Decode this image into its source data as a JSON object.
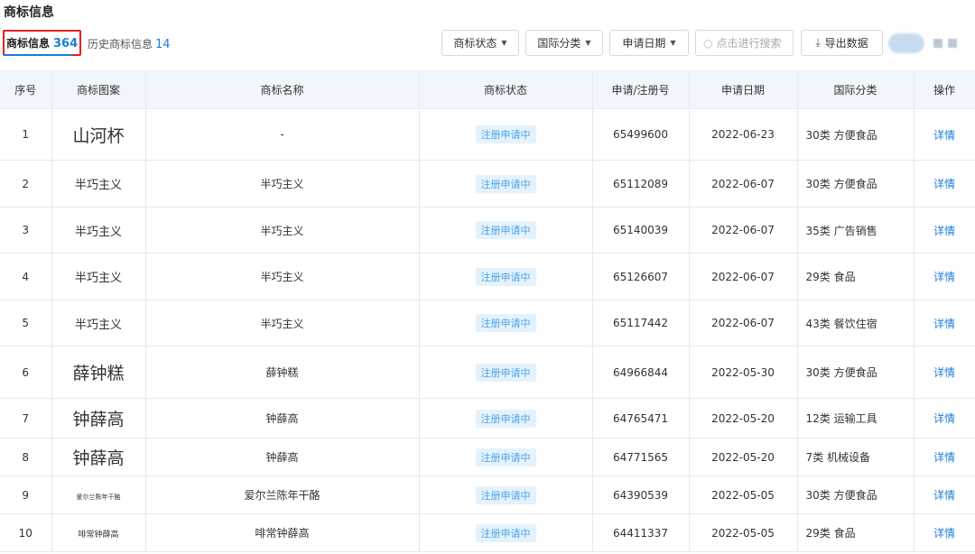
{
  "page": {
    "title": "商标信息"
  },
  "tabs": {
    "current": {
      "label": "商标信息",
      "count": "364"
    },
    "history": {
      "label": "历史商标信息",
      "count": "14"
    }
  },
  "toolbar": {
    "status_filter": "商标状态",
    "class_filter": "国际分类",
    "date_filter": "申请日期",
    "search_placeholder": "点击进行搜索",
    "export_label": "导出数据"
  },
  "table": {
    "headers": [
      "序号",
      "商标图案",
      "商标名称",
      "商标状态",
      "申请/注册号",
      "申请日期",
      "国际分类",
      "操作"
    ],
    "rows": [
      {
        "idx": "1",
        "logo": "山河杯",
        "name": "-",
        "status": "注册申请中",
        "reg": "65499600",
        "date": "2022-06-23",
        "cls": "30类 方便食品",
        "op": "详情"
      },
      {
        "idx": "2",
        "logo": "半巧主义",
        "name": "半巧主义",
        "status": "注册申请中",
        "reg": "65112089",
        "date": "2022-06-07",
        "cls": "30类 方便食品",
        "op": "详情"
      },
      {
        "idx": "3",
        "logo": "半巧主义",
        "name": "半巧主义",
        "status": "注册申请中",
        "reg": "65140039",
        "date": "2022-06-07",
        "cls": "35类 广告销售",
        "op": "详情"
      },
      {
        "idx": "4",
        "logo": "半巧主义",
        "name": "半巧主义",
        "status": "注册申请中",
        "reg": "65126607",
        "date": "2022-06-07",
        "cls": "29类 食品",
        "op": "详情"
      },
      {
        "idx": "5",
        "logo": "半巧主义",
        "name": "半巧主义",
        "status": "注册申请中",
        "reg": "65117442",
        "date": "2022-06-07",
        "cls": "43类 餐饮住宿",
        "op": "详情"
      },
      {
        "idx": "6",
        "logo": "薛钟糕",
        "name": "薛钟糕",
        "status": "注册申请中",
        "reg": "64966844",
        "date": "2022-05-30",
        "cls": "30类 方便食品",
        "op": "详情"
      },
      {
        "idx": "7",
        "logo": "钟薛高",
        "name": "钟薛高",
        "status": "注册申请中",
        "reg": "64765471",
        "date": "2022-05-20",
        "cls": "12类 运输工具",
        "op": "详情"
      },
      {
        "idx": "8",
        "logo": "钟薛高",
        "name": "钟薛高",
        "status": "注册申请中",
        "reg": "64771565",
        "date": "2022-05-20",
        "cls": "7类 机械设备",
        "op": "详情"
      },
      {
        "idx": "9",
        "logo": "爱尔兰陈年干酪",
        "name": "爱尔兰陈年干酪",
        "status": "注册申请中",
        "reg": "64390539",
        "date": "2022-05-05",
        "cls": "30类 方便食品",
        "op": "详情"
      },
      {
        "idx": "10",
        "logo": "啡常钟薛高",
        "name": "啡常钟薛高",
        "status": "注册申请中",
        "reg": "64411337",
        "date": "2022-05-05",
        "cls": "29类 食品",
        "op": "详情"
      }
    ]
  }
}
